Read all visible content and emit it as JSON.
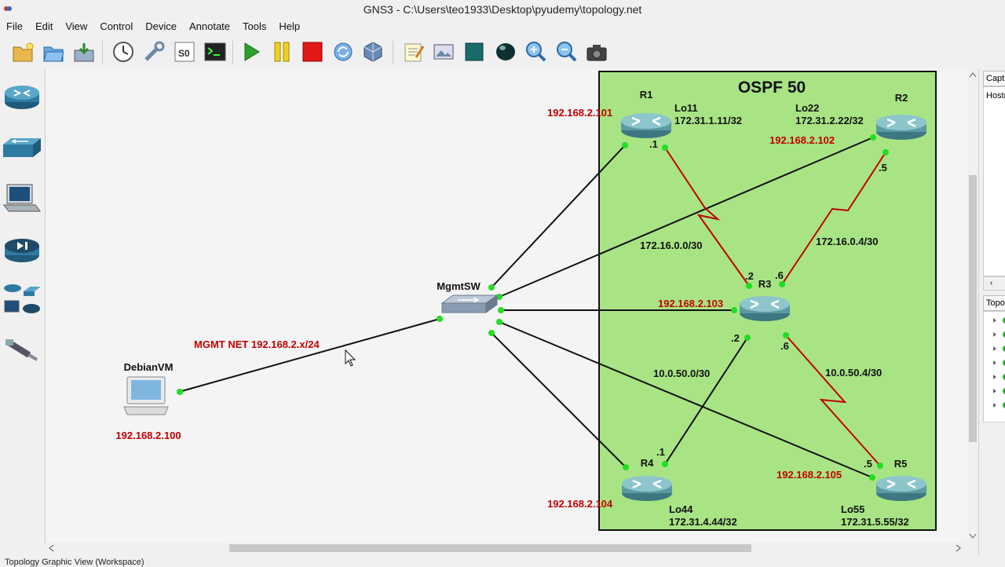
{
  "window": {
    "title": "GNS3 - C:\\Users\\teo1933\\Desktop\\pyudemy\\topology.net"
  },
  "menu": [
    "File",
    "Edit",
    "View",
    "Control",
    "Device",
    "Annotate",
    "Tools",
    "Help"
  ],
  "toolbar_icons": [
    "new-project-icon",
    "open-project-icon",
    "save-project-icon",
    "snapshot-icon",
    "preferences-icon",
    "show-interface-labels-icon",
    "console-all-icon",
    "start-all-icon",
    "suspend-all-icon",
    "stop-all-icon",
    "reload-all-icon",
    "virtualbox-icon",
    "add-note-icon",
    "insert-picture-icon",
    "draw-rectangle-icon",
    "draw-ellipse-icon",
    "zoom-in-icon",
    "zoom-out-icon",
    "screenshot-icon"
  ],
  "device_dock": [
    "routers-icon",
    "switches-icon",
    "end-devices-icon",
    "security-devices-icon",
    "all-devices-icon",
    "add-link-icon"
  ],
  "topology": {
    "area_title": "OSPF 50",
    "mgmt_net_label": "MGMT NET 192.168.2.x/24",
    "nodes": {
      "debian": {
        "name": "DebianVM",
        "ip": "192.168.2.100"
      },
      "switch": {
        "name": "MgmtSW"
      },
      "r1": {
        "name": "R1",
        "mgmt_ip": "192.168.2.101",
        "lo_name": "Lo11",
        "lo_ip": "172.31.1.11/32"
      },
      "r2": {
        "name": "R2",
        "mgmt_ip": "192.168.2.102",
        "lo_name": "Lo22",
        "lo_ip": "172.31.2.22/32"
      },
      "r3": {
        "name": "R3",
        "mgmt_ip": "192.168.2.103"
      },
      "r4": {
        "name": "R4",
        "mgmt_ip": "192.168.2.104",
        "lo_name": "Lo44",
        "lo_ip": "172.31.4.44/32"
      },
      "r5": {
        "name": "R5",
        "mgmt_ip": "192.168.2.105",
        "lo_name": "Lo55",
        "lo_ip": "172.31.5.55/32"
      }
    },
    "subnets": {
      "r1_r3": "172.16.0.0/30",
      "r2_r3": "172.16.0.4/30",
      "r3_r4": "10.0.50.0/30",
      "r3_r5": "10.0.50.4/30"
    },
    "if_octets": {
      "r1": ".1",
      "r3_to_r1": ".2",
      "r3_to_r2": ".6",
      "r2": ".5",
      "r3_to_r4": ".2",
      "r4": ".1",
      "r3_to_r5": ".6",
      "r5": ".5"
    }
  },
  "right_dock": {
    "captures_tab": "Captu",
    "captures_col": "Hostn",
    "topology_tab": "Topol"
  },
  "status": "Topology Graphic View (Workspace)",
  "colors": {
    "area_fill": "#a8e484",
    "serial_link": "#c00000",
    "port_up": "#22dd22",
    "ip_label": "#c00000"
  }
}
